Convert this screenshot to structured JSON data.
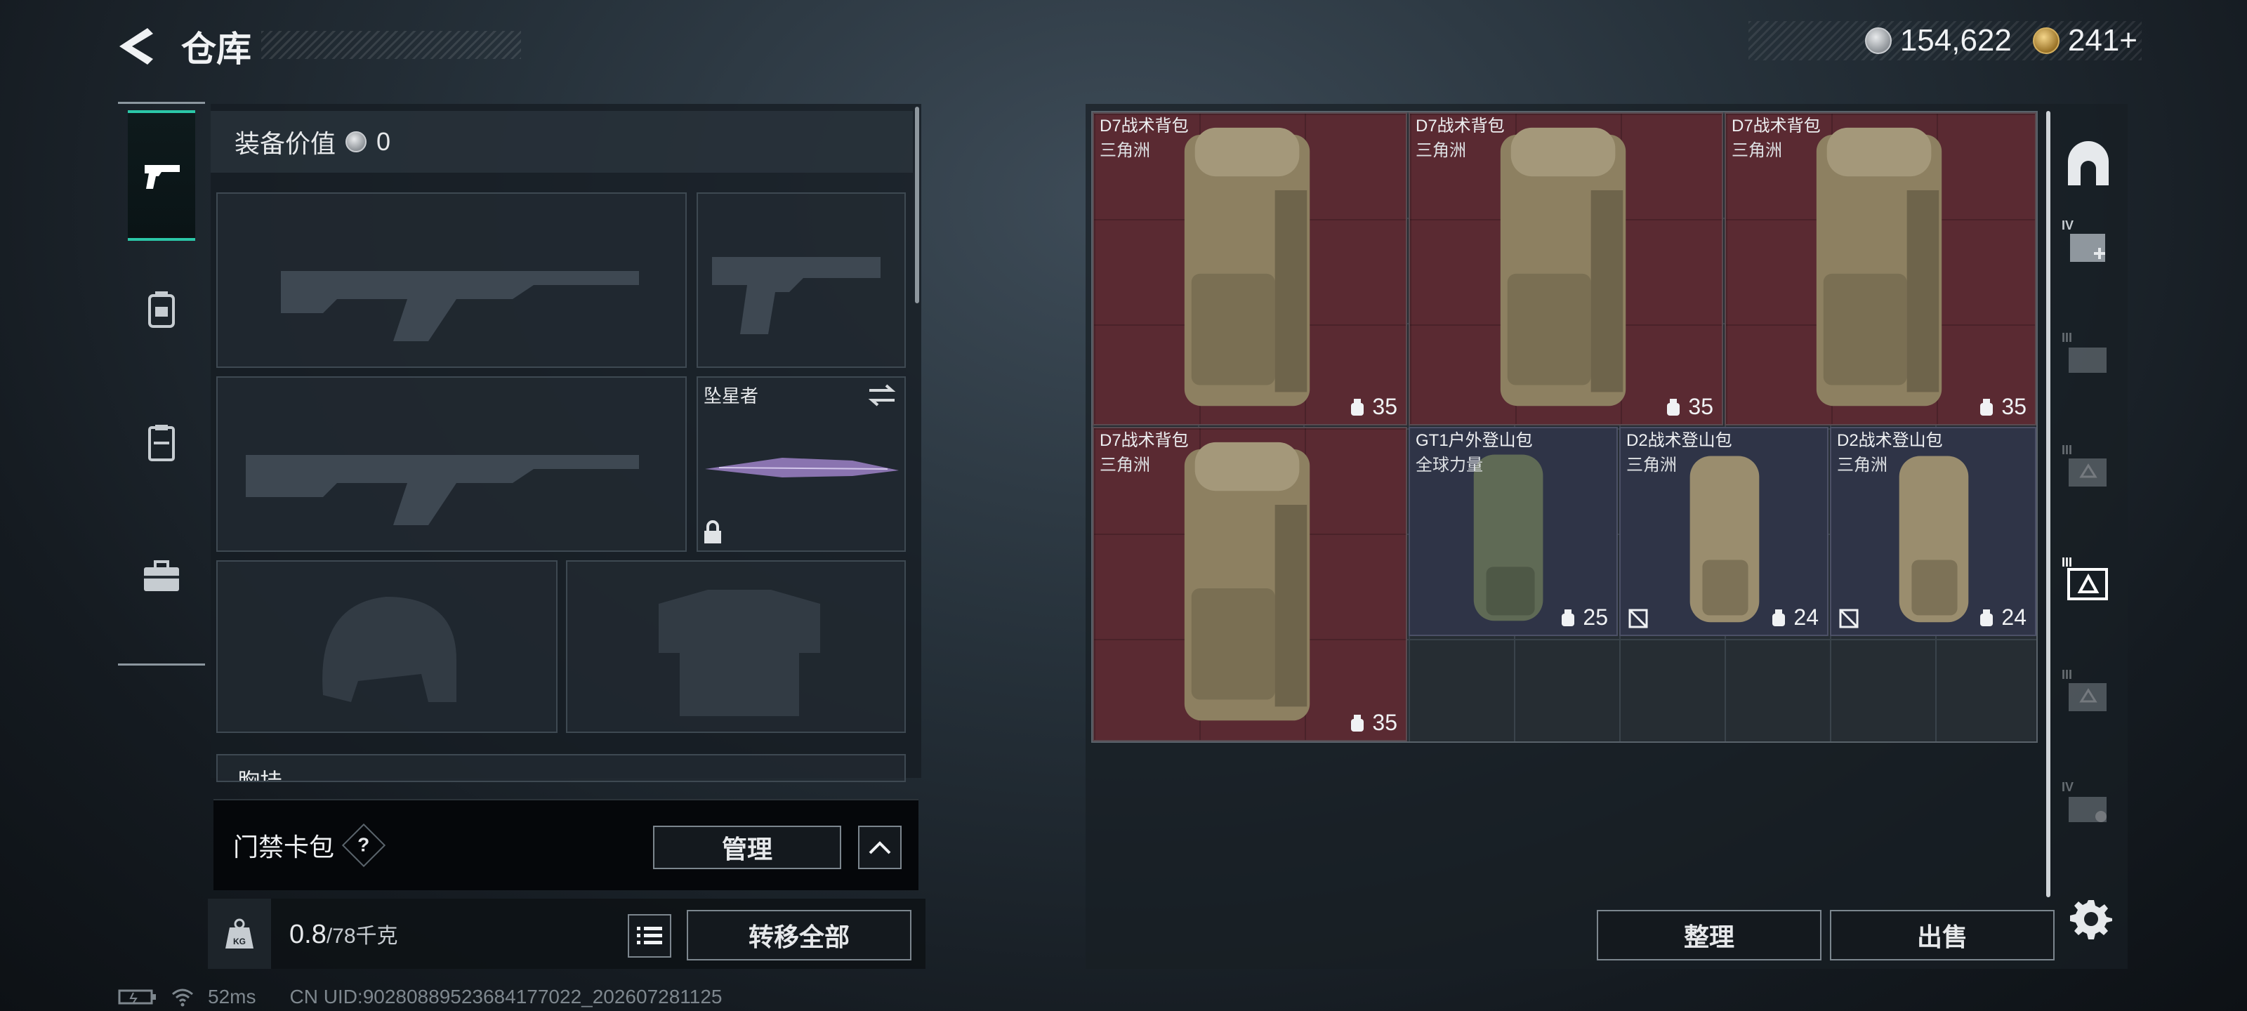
{
  "header": {
    "title": "仓库",
    "currency": [
      {
        "icon": "silver-coin-icon",
        "value": "154,622"
      },
      {
        "icon": "gold-coin-icon",
        "value": "241+"
      }
    ]
  },
  "loadout": {
    "equip_value_label": "装备价值",
    "equip_value": "0",
    "melee_name": "坠星者",
    "chest_rig_label": "胸挂",
    "card_pack_label": "门禁卡包",
    "help_mark": "?",
    "manage_label": "管理",
    "weight_current": "0.8",
    "weight_max": "/78千克",
    "weight_icon_text": "KG",
    "transfer_all_label": "转移全部"
  },
  "storage": {
    "items": [
      {
        "name": "D7战术背包",
        "sub": "三角洲",
        "capacity": "35",
        "style": "red"
      },
      {
        "name": "D7战术背包",
        "sub": "三角洲",
        "capacity": "35",
        "style": "red"
      },
      {
        "name": "D7战术背包",
        "sub": "三角洲",
        "capacity": "35",
        "style": "red"
      },
      {
        "name": "D7战术背包",
        "sub": "三角洲",
        "capacity": "35",
        "style": "red"
      },
      {
        "name": "GT1户外登山包",
        "sub": "全球力量",
        "capacity": "25",
        "style": "blue"
      },
      {
        "name": "D2战术登山包",
        "sub": "三角洲",
        "capacity": "24",
        "style": "blue"
      },
      {
        "name": "D2战术登山包",
        "sub": "三角洲",
        "capacity": "24",
        "style": "blue"
      }
    ],
    "sort_label": "整理",
    "sell_label": "出售"
  },
  "rail": {
    "tier_labels": [
      "IV",
      "III",
      "III",
      "III",
      "III",
      "IV"
    ]
  },
  "status": {
    "ping": "52ms",
    "uid": "CN UID:9028088952368417702​2_202607281125"
  }
}
